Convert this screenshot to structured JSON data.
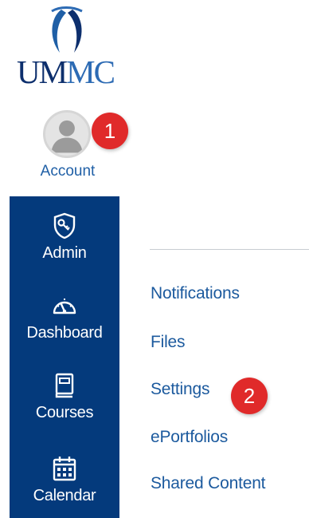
{
  "logo": {
    "text_part1": "UM",
    "text_part2": "MC",
    "colors": {
      "navy": "#0d2f6d",
      "blue": "#2d6bb4"
    },
    "icon": "ummc-logo-mark"
  },
  "account": {
    "label": "Account",
    "avatar_icon": "user-avatar-icon",
    "badge": "1"
  },
  "sidebar": {
    "background": "#043a7c",
    "items": [
      {
        "label": "Admin",
        "icon": "shield-key-icon"
      },
      {
        "label": "Dashboard",
        "icon": "speedometer-icon"
      },
      {
        "label": "Courses",
        "icon": "book-icon"
      },
      {
        "label": "Calendar",
        "icon": "calendar-icon"
      }
    ]
  },
  "tray": {
    "links": [
      {
        "label": "Notifications"
      },
      {
        "label": "Files"
      },
      {
        "label": "Settings",
        "badge": "2"
      },
      {
        "label": "ePortfolios"
      },
      {
        "label": "Shared Content"
      }
    ],
    "link_color": "#1c5a9e",
    "badge_color": "#e02a2a"
  }
}
